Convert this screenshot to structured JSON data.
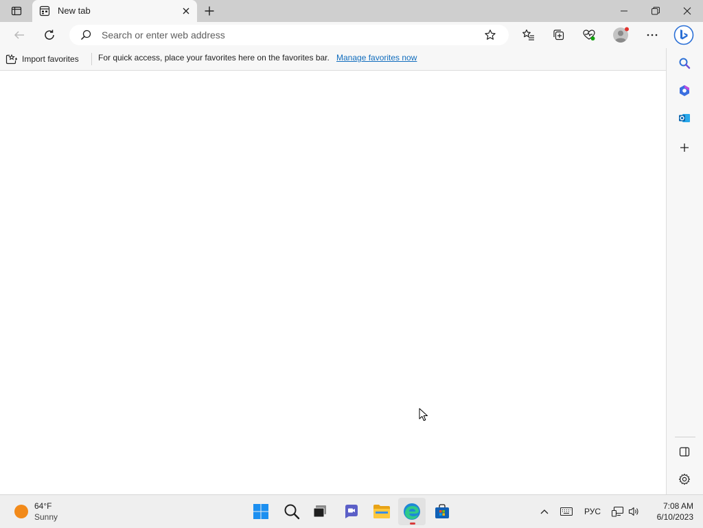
{
  "tab": {
    "title": "New tab",
    "close_tooltip": "Close tab"
  },
  "toolbar": {
    "search_placeholder": "Search or enter web address"
  },
  "favorites_bar": {
    "import_label": "Import favorites",
    "message": "For quick access, place your favorites here on the favorites bar.",
    "manage_link": "Manage favorites now"
  },
  "taskbar": {
    "weather": {
      "temp": "64°F",
      "condition": "Sunny"
    },
    "language": "РУС",
    "time": "7:08 AM",
    "date": "6/10/2023"
  },
  "colors": {
    "accent": "#0f6cbd",
    "tabstrip": "#cfcfcf",
    "toolbar": "#f7f7f7",
    "taskbar": "#efefef",
    "profile_badge": "#e3342f"
  },
  "icons": [
    "tab-actions-icon",
    "new-tab-page-icon",
    "close-icon",
    "plus-icon",
    "minimize-icon",
    "restore-icon",
    "window-close-icon",
    "back-arrow-icon",
    "refresh-icon",
    "search-icon",
    "star-icon",
    "favorites-icon",
    "collections-icon",
    "browser-essentials-icon",
    "profile-icon",
    "more-options-icon",
    "bing-copilot-icon",
    "import-favorites-icon",
    "sidebar-search-icon",
    "office-icon",
    "outlook-icon",
    "add-icon",
    "hide-sidebar-icon",
    "settings-icon",
    "windows-start-icon",
    "taskbar-search-icon",
    "task-view-icon",
    "teams-chat-icon",
    "file-explorer-icon",
    "edge-icon",
    "microsoft-store-icon",
    "show-hidden-icons-chevron-icon",
    "keyboard-icon",
    "network-icon",
    "volume-icon"
  ]
}
